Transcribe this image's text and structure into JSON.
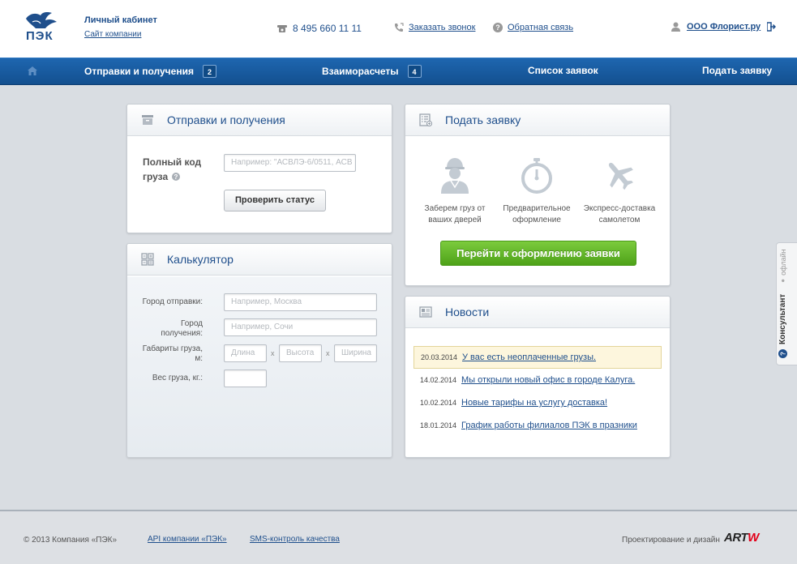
{
  "header": {
    "logo_text": "ПЭК",
    "cabinet_title": "Личный кабинет",
    "company_site": "Сайт компании",
    "phone": "8 495 660 11 11",
    "callback": "Заказать звонок",
    "feedback": "Обратная связь",
    "user_name": "ООО Флорист.ру"
  },
  "nav": {
    "items": [
      {
        "label": "Отправки и получения",
        "badge": "2"
      },
      {
        "label": "Взаиморасчеты",
        "badge": "4"
      },
      {
        "label": "Список заявок"
      },
      {
        "label": "Подать заявку"
      }
    ]
  },
  "tracking": {
    "title": "Отправки и получения",
    "code_label_line1": "Полный код",
    "code_label_line2": "груза",
    "code_placeholder": "Например: \"АСВЛЭ-6/0511, АСВ",
    "check_button": "Проверить статус"
  },
  "calculator": {
    "title": "Калькулятор",
    "from_label": "Город отправки:",
    "from_placeholder": "Например, Москва",
    "to_label_line1": "Город",
    "to_label_line2": "получения:",
    "to_placeholder": "Например, Сочи",
    "dims_label_line1": "Габариты груза,",
    "dims_label_line2": "м:",
    "length_placeholder": "Длина",
    "height_placeholder": "Высота",
    "width_placeholder": "Ширина",
    "separator": "x",
    "weight_label": "Вес груза, кг.:"
  },
  "order": {
    "title": "Подать заявку",
    "features": [
      {
        "icon": "courier-icon",
        "line1": "Заберем груз от",
        "line2": "ваших дверей"
      },
      {
        "icon": "stopwatch-icon",
        "line1": "Предварительное",
        "line2": "оформление"
      },
      {
        "icon": "airplane-icon",
        "line1": "Экспресс-доставка",
        "line2": "самолетом"
      }
    ],
    "go_button": "Перейти к оформлению заявки"
  },
  "news": {
    "title": "Новости",
    "items": [
      {
        "date": "20.03.2014",
        "text": "У вас есть неоплаченные грузы."
      },
      {
        "date": "14.02.2014",
        "text": "Мы открыли новый офис в городе Калуга."
      },
      {
        "date": "10.02.2014",
        "text": "Новые тарифы на услугу доставка!"
      },
      {
        "date": "18.01.2014",
        "text": "График работы филиалов ПЭК в празники"
      }
    ]
  },
  "consultant": {
    "label": "Консультант",
    "status": "офлайн"
  },
  "footer": {
    "copyright": "© 2013 Компания «ПЭК»",
    "api_link": "API компании «ПЭК»",
    "sms_link": "SMS-контроль качества",
    "designed_by": "Проектирование и дизайн",
    "studio_main": "ART",
    "studio_accent": "W"
  },
  "colors": {
    "brand_blue": "#1f4f8c",
    "nav_blue": "#1e66b0",
    "green_button": "#5fb326",
    "highlight": "#fdf6dd"
  }
}
